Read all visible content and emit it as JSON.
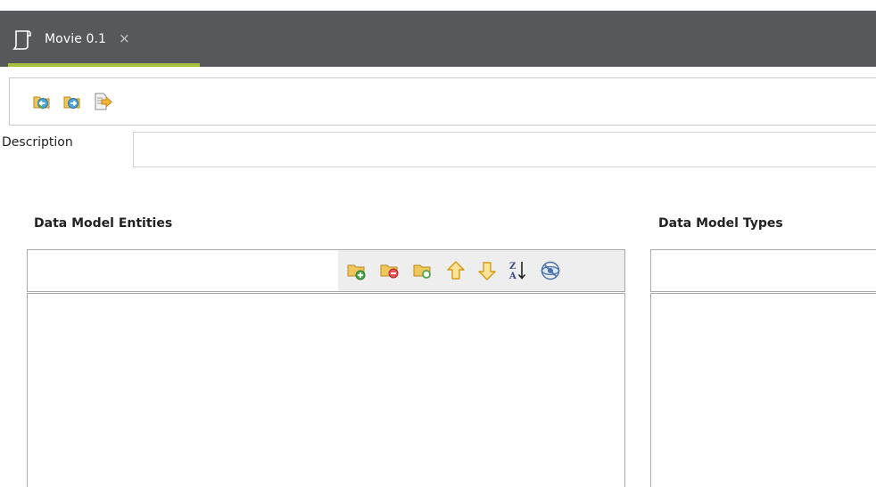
{
  "editor_tab": {
    "title": "Movie 0.1",
    "close_glyph": "×",
    "icon": "document-icon",
    "accent_color": "#a4c13a",
    "bar_color": "#56585c"
  },
  "editor_toolbar": {
    "buttons": [
      {
        "name": "import-icon"
      },
      {
        "name": "export-icon"
      },
      {
        "name": "deploy-icon"
      }
    ]
  },
  "description": {
    "label": "Description",
    "value": "",
    "placeholder": ""
  },
  "entities_panel": {
    "title": "Data Model Entities",
    "toolbar_icons": [
      "add-entity-icon",
      "remove-entity-icon",
      "new-entity-icon",
      "move-up-icon",
      "move-down-icon",
      "sort-icon",
      "hide-icon"
    ],
    "items": []
  },
  "types_panel": {
    "title": "Data Model Types",
    "items": []
  }
}
